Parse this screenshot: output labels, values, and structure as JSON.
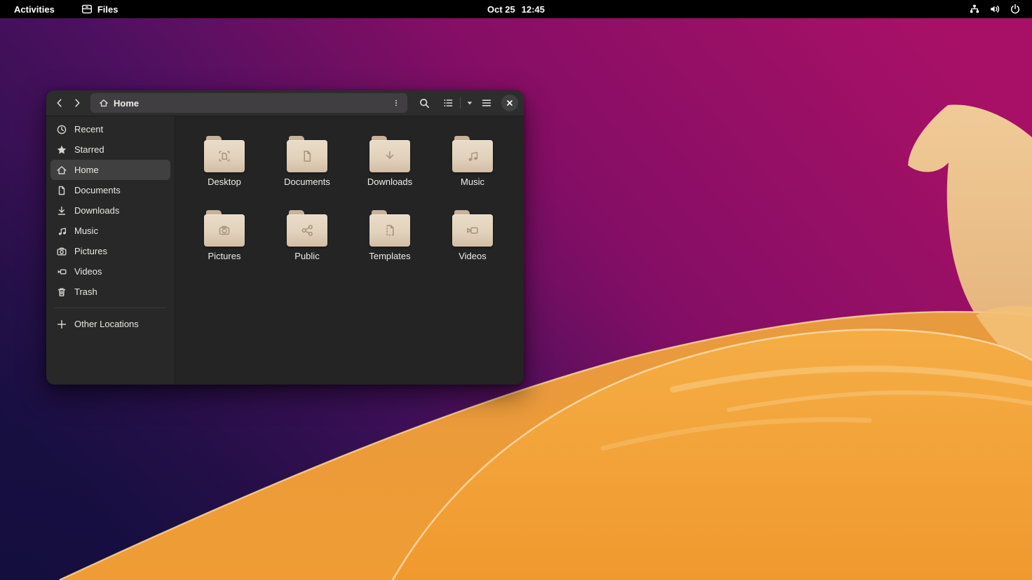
{
  "topbar": {
    "activities": "Activities",
    "app_name": "Files",
    "clock_date": "Oct 25",
    "clock_time": "12:45",
    "tray_icons": [
      "network-icon",
      "volume-icon",
      "power-icon"
    ]
  },
  "window": {
    "headerbar": {
      "path_label": "Home",
      "buttons": [
        "back",
        "forward",
        "path-menu",
        "search",
        "list-view-toggle",
        "main-menu",
        "close"
      ]
    },
    "sidebar": {
      "items": [
        {
          "label": "Recent",
          "icon": "recent-icon",
          "selected": false
        },
        {
          "label": "Starred",
          "icon": "star-icon",
          "selected": false
        },
        {
          "label": "Home",
          "icon": "home-icon",
          "selected": true
        },
        {
          "label": "Documents",
          "icon": "document-icon",
          "selected": false
        },
        {
          "label": "Downloads",
          "icon": "download-icon",
          "selected": false
        },
        {
          "label": "Music",
          "icon": "music-icon",
          "selected": false
        },
        {
          "label": "Pictures",
          "icon": "camera-icon",
          "selected": false
        },
        {
          "label": "Videos",
          "icon": "video-icon",
          "selected": false
        },
        {
          "label": "Trash",
          "icon": "trash-icon",
          "selected": false
        }
      ],
      "other_locations": "Other Locations"
    },
    "content": {
      "folders": [
        "Desktop",
        "Documents",
        "Downloads",
        "Music",
        "Pictures",
        "Public",
        "Templates",
        "Videos"
      ]
    }
  },
  "colors": {
    "topbar_bg": "#000000",
    "headerbar_bg": "#2d2d2d",
    "pathbar_bg": "#403e41",
    "sidebar_bg": "#282828",
    "content_bg": "#242424",
    "selected_row": "#404040",
    "folder_body": "#e2d2bc",
    "folder_tab": "#c8b29a",
    "wallpaper_purple_dark": "#1d1145",
    "wallpaper_magenta": "#a30f63",
    "wallpaper_orange": "#f1a03a",
    "wallpaper_peach_wave": "#eec795",
    "wallpaper_highlight": "#f7c271"
  }
}
